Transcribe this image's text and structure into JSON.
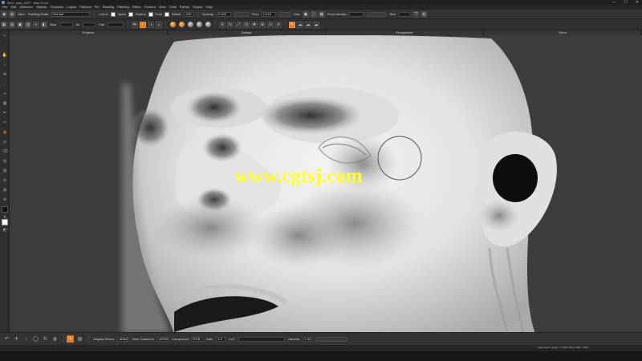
{
  "window": {
    "title": "BUG_man_002* - Mari 3.1v1",
    "controls": [
      "—",
      "☐",
      "✕"
    ]
  },
  "menu": [
    "File",
    "Edit",
    "Selection",
    "Objects",
    "Channels",
    "Layers",
    "Patches",
    "Pin",
    "Shading",
    "Painting",
    "Filters",
    "Camera",
    "View",
    "Tools",
    "Python",
    "Scripts",
    "Help"
  ],
  "toolbar1": {
    "hard_label": "Hard",
    "paint_mode_label": "Painting Mode",
    "paint_mode_value": "Normal",
    "colors_label": "Colors",
    "alpha_label": "Alpha",
    "radius_label": "Radius",
    "flow_label": "Flow",
    "radial_label": "Radial",
    "radial_value": "100",
    "opacity_label": "Opacity",
    "opacity_value": "0.100",
    "flow_value": "0.110",
    "max_label": "Max",
    "fixed_density_label": "Fixed density",
    "size_label": "Size"
  },
  "toolbar2": {
    "near_label": "Near",
    "far_label": "Far",
    "far_value": "far",
    "flat_label": "Flat"
  },
  "view_tabs": [
    "Projects",
    "Default",
    "Perspective",
    "Ortho"
  ],
  "viewport": {
    "watermark": "www.cgtsj.com"
  },
  "bottombar": {
    "display_device_label": "Display Device",
    "display_device_value": "default",
    "view_transform_label": "View Transform",
    "view_transform_value": "sRGB",
    "component_label": "Component",
    "component_value": "RGB",
    "gain_label": "Gain",
    "gain_value": "1.0",
    "lut_label": "LUT",
    "gamma_label": "Gamma",
    "gamma_value": "1.00"
  },
  "status": {
    "text": "Disk Cache Usage: 1.79GB Video: 1083 / 1908"
  },
  "colors": {
    "accent": "#e07b24",
    "watermark": "#ffff33"
  }
}
